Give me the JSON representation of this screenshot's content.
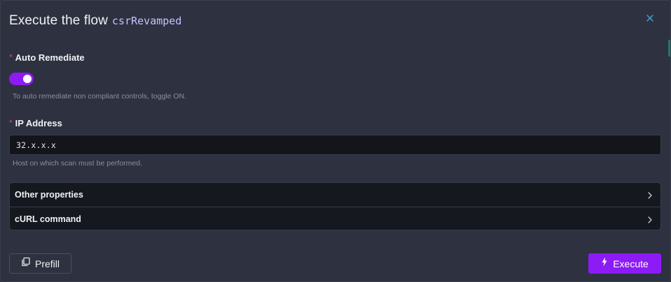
{
  "header": {
    "title": "Execute the flow",
    "flow_name": "csrRevamped",
    "close_icon": "close-icon"
  },
  "fields": {
    "auto_remediate": {
      "required_mark": "*",
      "label": "Auto Remediate",
      "enabled": true,
      "help": "To auto remediate non compliant controls, toggle ON."
    },
    "ip_address": {
      "required_mark": "*",
      "label": "IP Address",
      "value": "32.x.x.x",
      "help": "Host on which scan must be performed."
    }
  },
  "accordion": {
    "items": [
      {
        "label": "Other properties",
        "icon": "chevron-right-icon"
      },
      {
        "label": "cURL command",
        "icon": "chevron-right-icon"
      }
    ]
  },
  "footer": {
    "prefill_label": "Prefill",
    "prefill_icon": "copy-icon",
    "execute_label": "Execute",
    "execute_icon": "lightning-icon"
  },
  "colors": {
    "accent": "#8c1bf5",
    "background": "#2e313f",
    "input_background": "#13151b",
    "required": "#e5484d",
    "flow_name": "#c7c2ff"
  }
}
